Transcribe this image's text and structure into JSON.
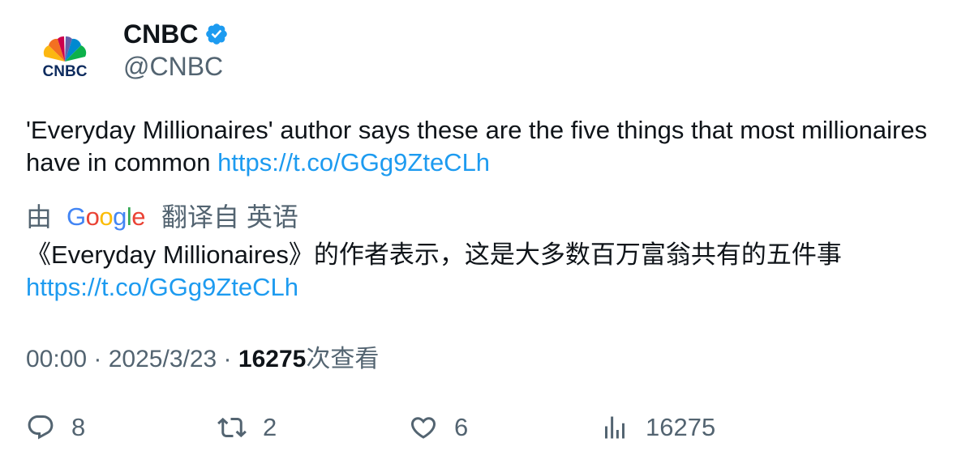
{
  "author": {
    "display_name": "CNBC",
    "handle": "@CNBC",
    "logo_text": "CNBC",
    "verified_icon": "verified-badge-icon"
  },
  "tweet": {
    "text": "'Everyday Millionaires' author says these are the five things that most millionaires have in common ",
    "link": "https://t.co/GGg9ZteCLh"
  },
  "translation": {
    "prefix": "由",
    "provider": "Google",
    "suffix": "翻译自 英语",
    "text": "《Everyday Millionaires》的作者表示，这是大多数百万富翁共有的五件事",
    "link": "https://t.co/GGg9ZteCLh"
  },
  "meta": {
    "time": "00:00",
    "sep1": " · ",
    "date": "2025/3/23",
    "sep2": " · ",
    "views": "16275",
    "views_label": "次查看"
  },
  "actions": {
    "replies": "8",
    "retweets": "2",
    "likes": "6",
    "views": "16275"
  },
  "colors": {
    "link": "#1d9bf0",
    "secondary_text": "#536471",
    "verified": "#1d9bf0"
  }
}
